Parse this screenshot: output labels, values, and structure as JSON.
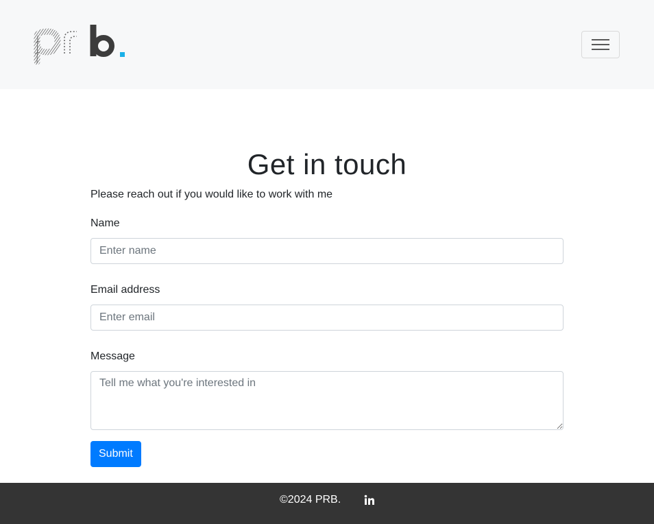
{
  "brand": {
    "logo_text": "prb.",
    "accent_color": "#1ab0e8"
  },
  "navbar": {
    "toggle_icon": "hamburger-menu-icon"
  },
  "contact": {
    "title": "Get in touch",
    "subtitle": "Please reach out if you would like to work with me",
    "name_label": "Name",
    "name_placeholder": "Enter name",
    "email_label": "Email address",
    "email_placeholder": "Enter email",
    "message_label": "Message",
    "message_placeholder": "Tell me what you're interested in",
    "submit_label": "Submit",
    "submit_color": "#007bff"
  },
  "footer": {
    "copyright": "©2024 PRB.",
    "social_icon": "linkedin-icon"
  }
}
